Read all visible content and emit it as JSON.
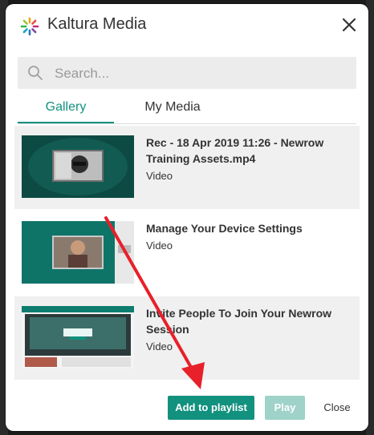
{
  "dialog": {
    "title": "Kaltura Media",
    "close_icon": "close-icon"
  },
  "search": {
    "placeholder": "Search..."
  },
  "tabs": [
    {
      "label": "Gallery",
      "active": true
    },
    {
      "label": "My Media",
      "active": false
    }
  ],
  "media": [
    {
      "name": "Rec - 18 Apr 2019 11:26 - Newrow Training Assets.mp4",
      "type": "Video"
    },
    {
      "name": "Manage Your Device Settings",
      "type": "Video"
    },
    {
      "name": "Invite People To Join Your Newrow Session",
      "type": "Video"
    }
  ],
  "footer": {
    "add_label": "Add to playlist",
    "play_label": "Play",
    "close_label": "Close"
  },
  "colors": {
    "accent": "#12917f",
    "accent_disabled": "#9fd2c9",
    "annotation_arrow": "#e8202a"
  }
}
